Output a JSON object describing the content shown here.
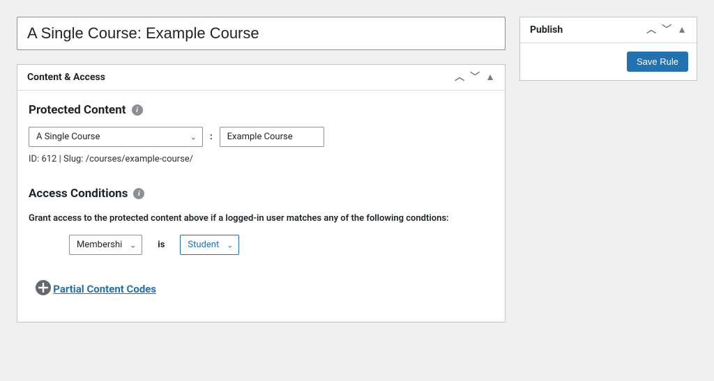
{
  "title_value": "A Single Course: Example Course",
  "publish_panel": {
    "title": "Publish",
    "save_btn": "Save Rule"
  },
  "content_panel": {
    "title": "Content & Access",
    "protected_heading": "Protected Content",
    "type_select": "A Single Course",
    "item_input": "Example Course",
    "meta": "ID: 612 | Slug: /courses/example-course/",
    "access_heading": "Access Conditions",
    "access_desc": "Grant access to the protected content above if a logged-in user matches any of the following condtions:",
    "cond_type": "Membershi",
    "cond_op": "is",
    "cond_value": "Student",
    "partial_link": "Partial Content Codes"
  }
}
